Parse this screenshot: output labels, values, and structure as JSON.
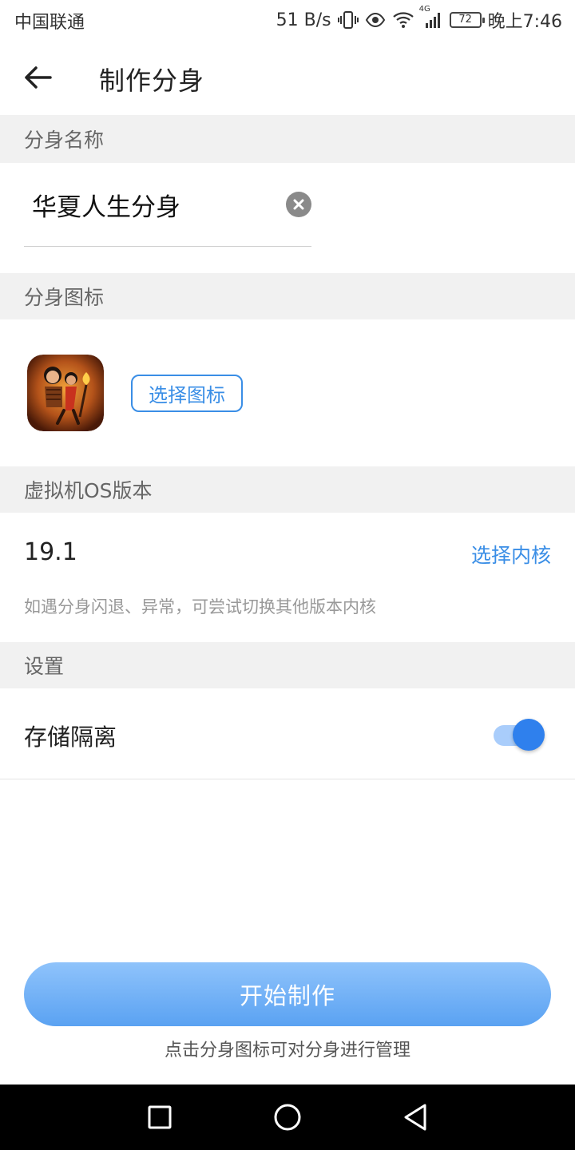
{
  "status_bar": {
    "carrier": "中国联通",
    "net_speed": "51 B/s",
    "network_type": "4G",
    "battery": "72",
    "time": "晚上7:46",
    "icons": [
      "vibrate-icon",
      "eye-icon",
      "wifi-icon",
      "signal-icon",
      "battery-icon"
    ]
  },
  "header": {
    "title": "制作分身",
    "back_icon": "arrow-left-icon"
  },
  "sections": {
    "name": {
      "header": "分身名称",
      "value": "华夏人生分身",
      "clear_icon": "clear-icon"
    },
    "icon": {
      "header": "分身图标",
      "choose_label": "选择图标"
    },
    "os": {
      "header": "虚拟机OS版本",
      "version": "19.1",
      "choose_kernel_label": "选择内核",
      "hint": "如遇分身闪退、异常，可尝试切换其他版本内核"
    },
    "settings": {
      "header": "设置",
      "storage_isolation_label": "存储隔离",
      "storage_isolation_on": true
    }
  },
  "footer": {
    "start_label": "开始制作",
    "hint": "点击分身图标可对分身进行管理"
  },
  "colors": {
    "accent": "#3a8ee6",
    "button_gradient_top": "#8fc3fb",
    "button_gradient_bottom": "#5aa2f2",
    "section_bg": "#f1f1f1"
  },
  "nav_bar": {
    "icons": [
      "square-icon",
      "circle-icon",
      "triangle-back-icon"
    ]
  }
}
